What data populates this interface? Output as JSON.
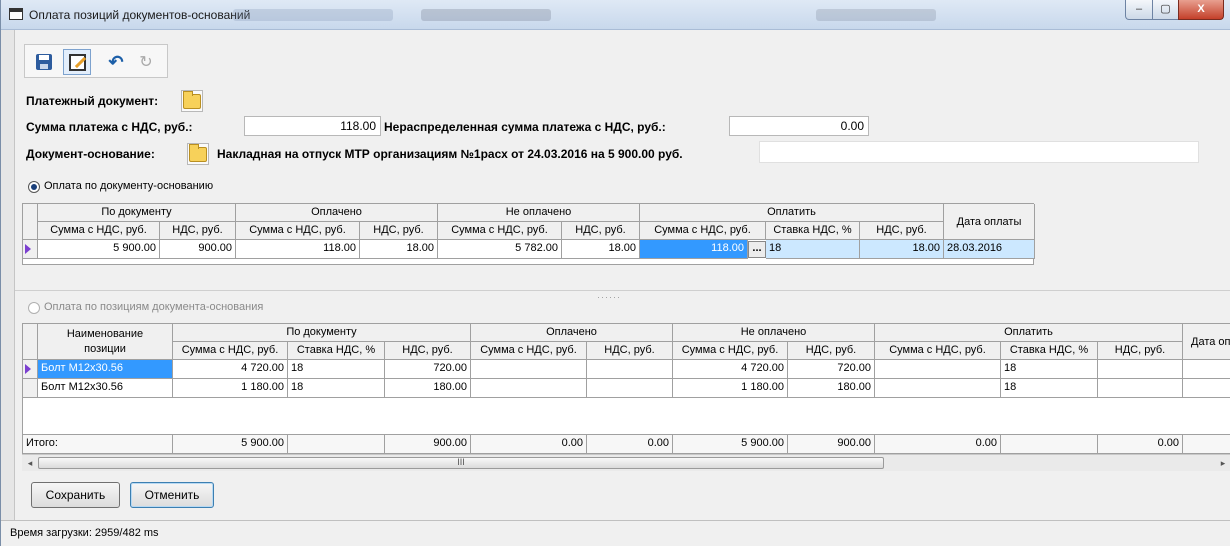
{
  "window": {
    "title": "Оплата позиций документов-оснований",
    "minimize": "‒",
    "maximize": "▢",
    "close": "X"
  },
  "toolbar": {
    "save": "save-icon",
    "edit": "edit-icon",
    "undo": "undo-icon",
    "redo": "redo-icon"
  },
  "form": {
    "payment_doc_label": "Платежный документ:",
    "payment_sum_label": "Сумма платежа с НДС, руб.:",
    "payment_sum_value": "118.00",
    "unallocated_label": "Нераспределенная сумма платежа с НДС, руб.:",
    "unallocated_value": "0.00",
    "base_doc_label": "Документ-основание:",
    "base_doc_value": "Накладная на отпуск МТР организациям №1расх от 24.03.2016 на  5 900.00 руб."
  },
  "mode1": {
    "label": "Оплата по документу-основанию",
    "groups": [
      "По документу",
      "Оплачено",
      "Не оплачено",
      "Оплатить"
    ],
    "date_header": "Дата оплаты",
    "cols": [
      "Сумма с НДС, руб.",
      "НДС, руб.",
      "Сумма с НДС, руб.",
      "НДС, руб.",
      "Сумма с НДС, руб.",
      "НДС, руб.",
      "Сумма с НДС, руб.",
      "Ставка НДС, %",
      "НДС, руб."
    ],
    "row": [
      "5 900.00",
      "900.00",
      "118.00",
      "18.00",
      "5 782.00",
      "18.00",
      "118.00",
      "18",
      "18.00",
      "28.03.2016"
    ],
    "ellipsis": "..."
  },
  "mode2": {
    "label": "Оплата по позициям документа-основания",
    "name_header": "Наименование позиции",
    "groups": [
      "По документу",
      "Оплачено",
      "Не оплачено",
      "Оплатить"
    ],
    "date_header": "Дата оп",
    "cols": [
      "Сумма с НДС, руб.",
      "Ставка НДС, %",
      "НДС, руб.",
      "Сумма с НДС, руб.",
      "НДС, руб.",
      "Сумма с НДС, руб.",
      "НДС, руб.",
      "Сумма с НДС, руб.",
      "Ставка НДС, %",
      "НДС, руб."
    ],
    "rows": [
      [
        "Болт М12х30.56",
        "4 720.00",
        "18",
        "720.00",
        "",
        "",
        "4 720.00",
        "720.00",
        "",
        "18",
        ""
      ],
      [
        "Болт М12х30.56",
        "1 180.00",
        "18",
        "180.00",
        "",
        "",
        "1 180.00",
        "180.00",
        "",
        "18",
        ""
      ]
    ],
    "total": [
      "Итого:",
      "5 900.00",
      "",
      "900.00",
      "0.00",
      "0.00",
      "5 900.00",
      "900.00",
      "0.00",
      "",
      "0.00"
    ],
    "scroll_left": "◂",
    "scroll_right": "▸",
    "scroll_grip": "III"
  },
  "buttons": {
    "save": "Сохранить",
    "cancel": "Отменить"
  },
  "status": {
    "load_time": "Время загрузки: 2959/482 ms"
  }
}
